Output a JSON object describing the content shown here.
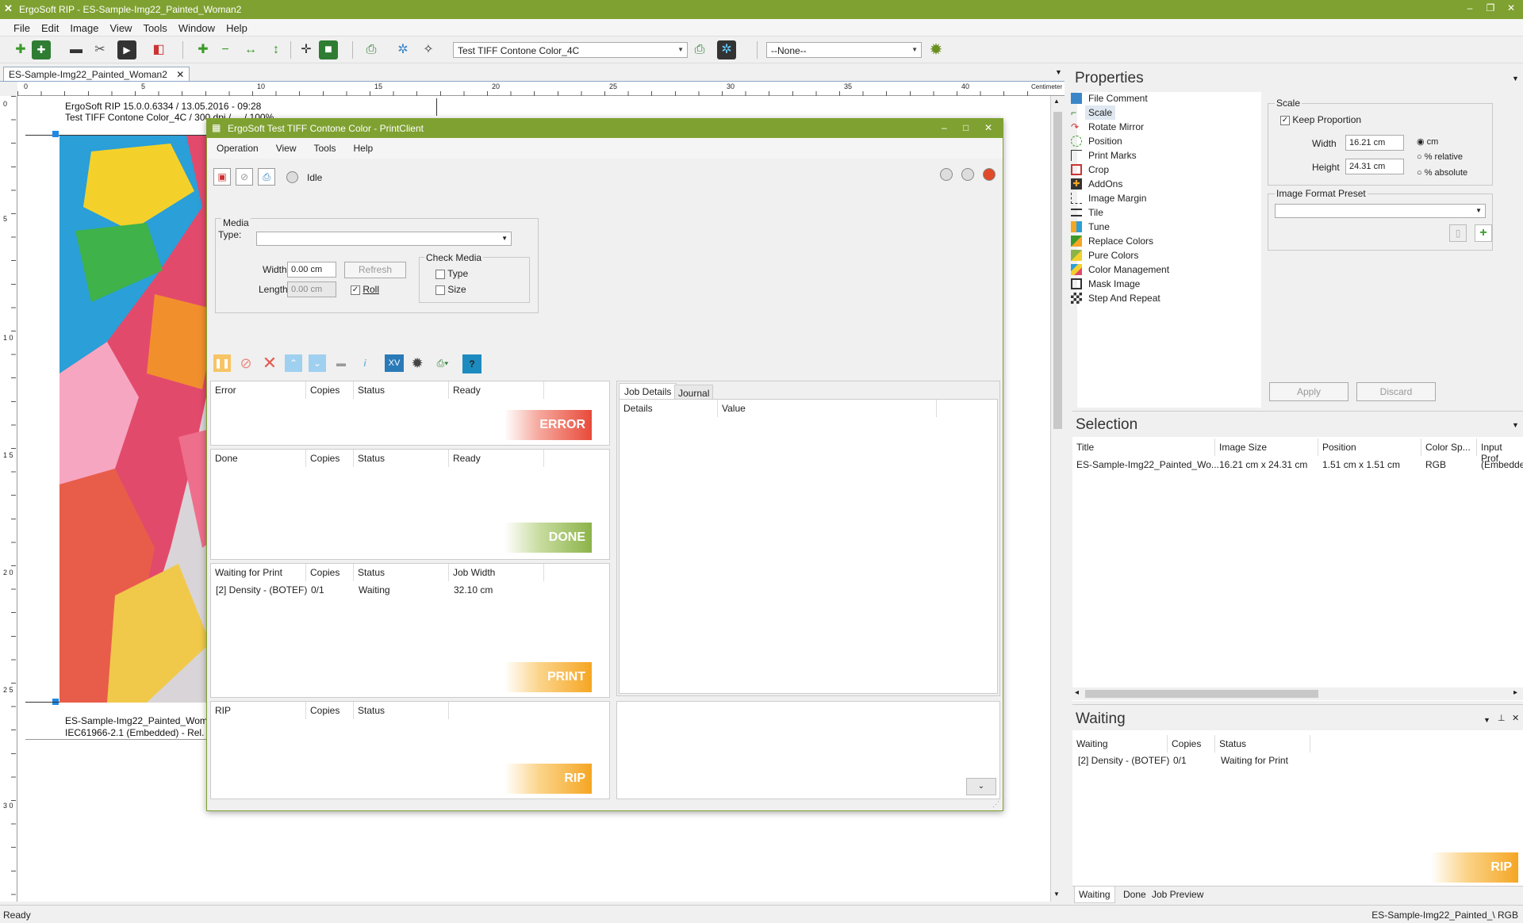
{
  "window": {
    "title": "ErgoSoft RIP - ES-Sample-Img22_Painted_Woman2"
  },
  "menu": [
    "File",
    "Edit",
    "Image",
    "View",
    "Tools",
    "Window",
    "Help"
  ],
  "toolbar": {
    "profile_combo": "Test TIFF Contone Color_4C",
    "none_combo": "--None--"
  },
  "doc_tab": "ES-Sample-Img22_Painted_Woman2",
  "ruler": {
    "ticks": [
      "0",
      "5",
      "10",
      "15",
      "20",
      "25",
      "30",
      "35",
      "40"
    ],
    "unit": "Centimeter"
  },
  "vruler": {
    "ticks": [
      "0",
      "5",
      "1 0",
      "1 5",
      "2 0",
      "2 5",
      "3 0"
    ]
  },
  "canvas": {
    "header_line1": "ErgoSoft RIP 15.0.0.6334 / 13.05.2016 - 09:28",
    "header_line2": "Test TIFF Contone Color_4C / 300 dpi / ... / 100%",
    "footer_line1": "ES-Sample-Img22_Painted_Wom",
    "footer_line2": "IEC61966-2.1 (Embedded) - Rel."
  },
  "dialog": {
    "title": "ErgoSoft Test TIFF Contone Color - PrintClient",
    "menu": [
      "Operation",
      "View",
      "Tools",
      "Help"
    ],
    "status": "Idle",
    "media": {
      "group": "Media",
      "type_label": "Type:",
      "width_label": "Width:",
      "width_value": "0.00 cm",
      "length_label": "Length:",
      "length_value": "0.00 cm",
      "refresh": "Refresh",
      "roll": "Roll",
      "check_media": "Check Media",
      "check_type": "Type",
      "check_size": "Size"
    },
    "error_panel": {
      "cols": [
        "Error",
        "Copies",
        "Status",
        "Ready"
      ],
      "badge": "ERROR"
    },
    "done_panel": {
      "cols": [
        "Done",
        "Copies",
        "Status",
        "Ready"
      ],
      "badge": "DONE"
    },
    "print_panel": {
      "cols": [
        "Waiting for Print",
        "Copies",
        "Status",
        "Job Width"
      ],
      "rows": [
        [
          "[2]  Density - (BOTEF)",
          "0/1",
          "Waiting",
          "32.10 cm"
        ]
      ],
      "badge": "PRINT"
    },
    "rip_panel": {
      "cols": [
        "RIP",
        "Copies",
        "Status"
      ],
      "badge": "RIP"
    },
    "details": {
      "tabs": [
        "Job Details",
        "Journal"
      ],
      "cols": [
        "Details",
        "Value"
      ]
    }
  },
  "properties": {
    "title": "Properties",
    "items": [
      "File Comment",
      "Scale",
      "Rotate Mirror",
      "Position",
      "Print Marks",
      "Crop",
      "AddOns",
      "Image Margin",
      "Tile",
      "Tune",
      "Replace Colors",
      "Pure Colors",
      "Color Management",
      "Mask Image",
      "Step And Repeat"
    ],
    "scale": {
      "group": "Scale",
      "keep": "Keep Proportion",
      "width_label": "Width",
      "width": "16.21 cm",
      "height_label": "Height",
      "height": "24.31 cm",
      "opt_cm": "cm",
      "opt_rel": "% relative",
      "opt_abs": "% absolute",
      "preset": "Image Format Preset"
    },
    "apply": "Apply",
    "discard": "Discard"
  },
  "selection": {
    "title": "Selection",
    "cols": [
      "Title",
      "Image Size",
      "Position",
      "Color Sp...",
      "Input Prof"
    ],
    "row": [
      "ES-Sample-Img22_Painted_Wo...",
      "16.21 cm x 24.31 cm",
      "1.51 cm x 1.51 cm",
      "RGB",
      "(Embedde"
    ]
  },
  "waiting": {
    "title": "Waiting",
    "cols": [
      "Waiting",
      "Copies",
      "Status"
    ],
    "row": [
      "[2]  Density - (BOTEF)",
      "0/1",
      "Waiting for Print"
    ],
    "badge": "RIP",
    "tabs": [
      "Waiting",
      "Done",
      "Job Preview"
    ]
  },
  "status": {
    "left": "Ready",
    "right": "ES-Sample-Img22_Painted_\\  RGB"
  }
}
